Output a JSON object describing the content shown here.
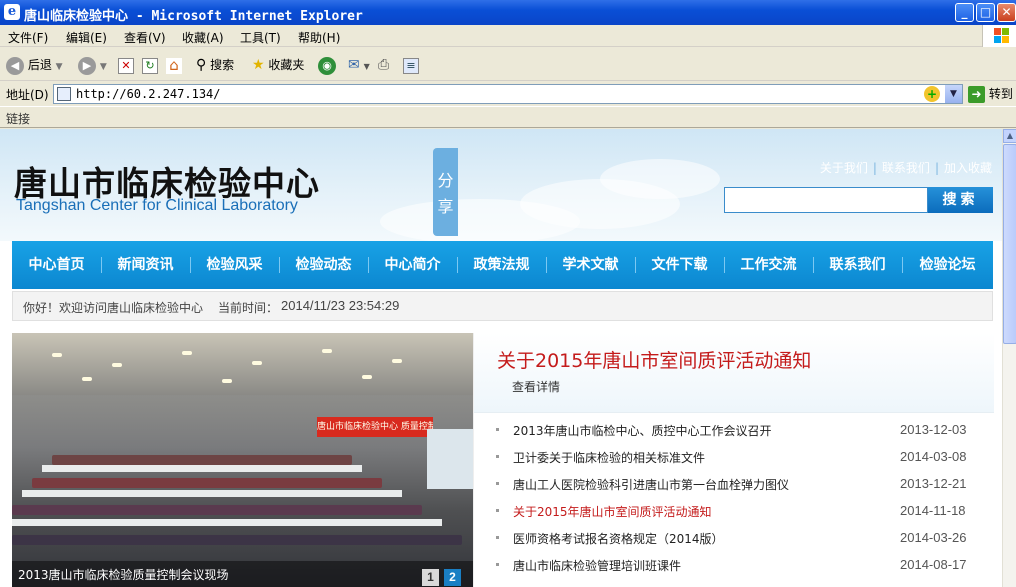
{
  "window": {
    "title": "唐山临床检验中心 - Microsoft Internet Explorer",
    "buttons": {
      "minimize": "_",
      "maximize": "□",
      "close": "✕"
    }
  },
  "menu": [
    "文件(F)",
    "编辑(E)",
    "查看(V)",
    "收藏(A)",
    "工具(T)",
    "帮助(H)"
  ],
  "toolbar": {
    "back": "后退",
    "search": "搜索",
    "favorites": "收藏夹"
  },
  "address": {
    "label": "地址(D)",
    "url": "http://60.2.247.134/",
    "go": "转到"
  },
  "links_label": "链接",
  "site": {
    "title": "唐山市临床检验中心",
    "subtitle": "Tangshan Center for Clinical Laboratory",
    "share": "分享",
    "top_links": [
      "关于我们",
      "联系我们",
      "加入收藏"
    ],
    "search_button": "搜索",
    "nav": [
      "中心首页",
      "新闻资讯",
      "检验风采",
      "检验动态",
      "中心简介",
      "政策法规",
      "学术文献",
      "文件下载",
      "工作交流",
      "联系我们",
      "检验论坛"
    ],
    "welcome": "你好！欢迎访问唐山临床检验中心",
    "time_label": "当前时间：",
    "time_value": "2014/11/23 23:54:29",
    "photo_caption": "2013唐山市临床检验质量控制会议现场",
    "photo_banner": "唐山市临床检验中心 质量控制工作会议",
    "pager": [
      "1",
      "2"
    ],
    "headline": "关于2015年唐山市室间质评活动通知",
    "headline_link": "查看详情",
    "news": [
      {
        "title": "2013年唐山市临检中心、质控中心工作会议召开",
        "date": "2013-12-03",
        "hot": false
      },
      {
        "title": "卫计委关于临床检验的相关标准文件",
        "date": "2014-03-08",
        "hot": false
      },
      {
        "title": "唐山工人医院检验科引进唐山市第一台血栓弹力图仪",
        "date": "2013-12-21",
        "hot": false
      },
      {
        "title": "关于2015年唐山市室间质评活动通知",
        "date": "2014-11-18",
        "hot": true
      },
      {
        "title": "医师资格考试报名资格规定（2014版）",
        "date": "2014-03-26",
        "hot": false
      },
      {
        "title": "唐山市临床检验管理培训班课件",
        "date": "2014-08-17",
        "hot": false
      }
    ]
  }
}
